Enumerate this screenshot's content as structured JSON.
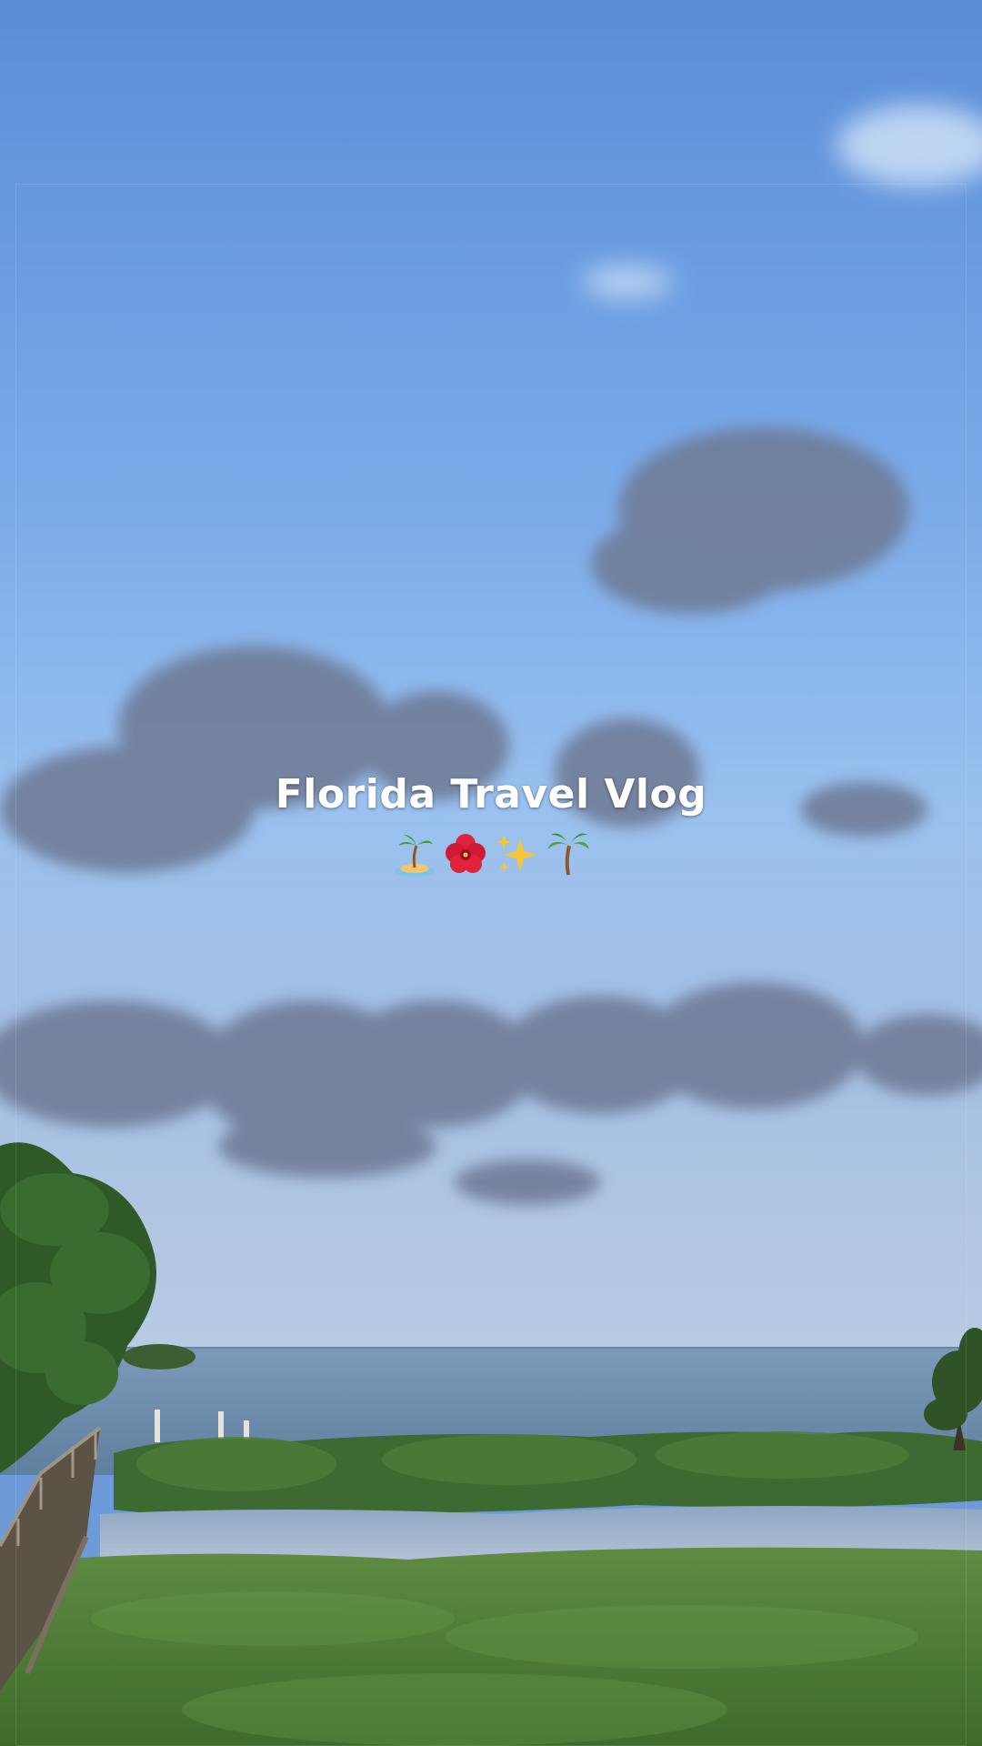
{
  "overlay": {
    "title": "Florida Travel Vlog",
    "emojis": [
      "desert-island-icon",
      "hibiscus-icon",
      "sparkles-icon",
      "palm-tree-icon"
    ]
  },
  "colors": {
    "sky_top": "#5b8fd8",
    "sky_mid": "#86b3ec",
    "sky_horizon": "#a9c3e6",
    "cloud": "#6f7f9a",
    "sea": "#6f8fb0",
    "mangrove": "#3f6b33",
    "lawn": "#55803c",
    "title_text": "#ffffff"
  }
}
